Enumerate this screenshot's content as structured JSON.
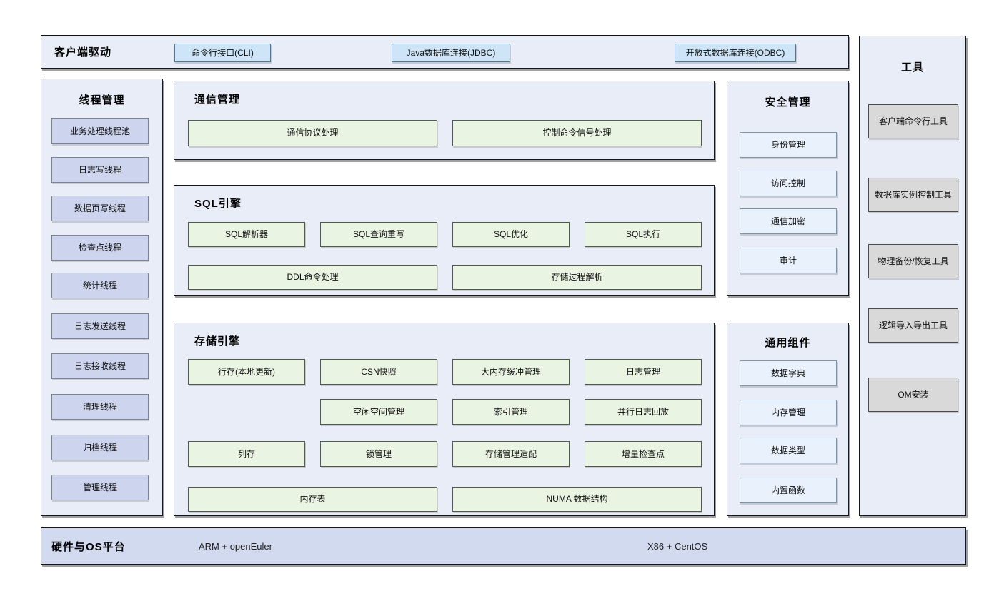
{
  "top_bar": {
    "title": "客户端驱动",
    "buttons": [
      "命令行接口(CLI)",
      "Java数据库连接(JDBC)",
      "开放式数据库连接(ODBC)"
    ]
  },
  "thread_mgmt": {
    "title": "线程管理",
    "items": [
      "业务处理线程池",
      "日志写线程",
      "数据页写线程",
      "检查点线程",
      "统计线程",
      "日志发送线程",
      "日志接收线程",
      "清理线程",
      "归档线程",
      "管理线程"
    ]
  },
  "comm_mgmt": {
    "title": "通信管理",
    "items": [
      "通信协议处理",
      "控制命令信号处理"
    ]
  },
  "sql_engine": {
    "title": "SQL引擎",
    "row1": [
      "SQL解析器",
      "SQL查询重写",
      "SQL优化",
      "SQL执行"
    ],
    "row2": [
      "DDL命令处理",
      "存储过程解析"
    ]
  },
  "storage_engine": {
    "title": "存储引擎",
    "rows": [
      [
        "行存(本地更新)",
        "CSN快照",
        "大内存缓冲管理",
        "日志管理"
      ],
      [
        "空闲空间管理",
        "索引管理",
        "并行日志回放"
      ],
      [
        "列存",
        "锁管理",
        "存储管理适配",
        "增量检查点"
      ],
      [
        "内存表",
        "NUMA 数据结构"
      ]
    ]
  },
  "security": {
    "title": "安全管理",
    "items": [
      "身份管理",
      "访问控制",
      "通信加密",
      "审计"
    ]
  },
  "common": {
    "title": "通用组件",
    "items": [
      "数据字典",
      "内存管理",
      "数据类型",
      "内置函数"
    ]
  },
  "tools": {
    "title": "工具",
    "items": [
      "客户端命令行工具",
      "数据库实例控制工具",
      "物理备份/恢复工具",
      "逻辑导入导出工具",
      "OM安装"
    ]
  },
  "platform": {
    "title": "硬件与OS平台",
    "items": [
      "ARM + openEuler",
      "X86 + CentOS"
    ]
  },
  "colors": {
    "panel_fill": "#e8edf8",
    "blue_button": "#cde5f7",
    "lavender_button": "#ccd4ee",
    "green_button": "#eaf4e3",
    "pale_blue_button": "#e9f2fc",
    "gray_button": "#d9d9d9",
    "platform_bar": "#d2daf0"
  }
}
